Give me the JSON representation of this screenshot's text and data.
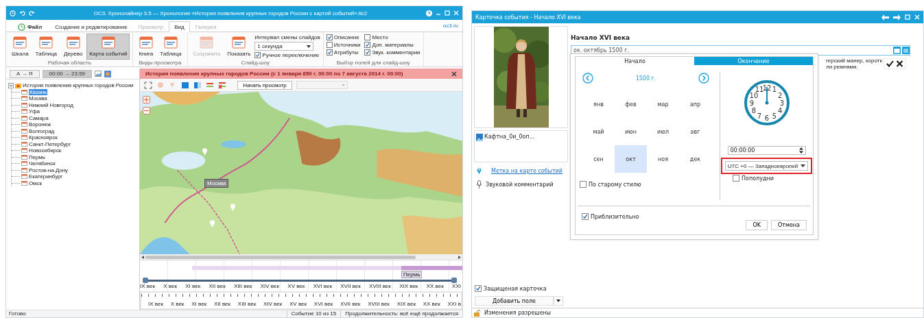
{
  "left_window": {
    "title": "ОС3. Хронолайнер 3.5 — Хронология «История появления крупных городов России с картой событий».tlc2",
    "ribbon_tabs": [
      {
        "label": "Файл",
        "kind": "file",
        "selected": false,
        "disabled": false
      },
      {
        "label": "Создание и редактирование",
        "kind": "tab",
        "selected": false,
        "disabled": false
      },
      {
        "label": "Просмотр",
        "kind": "tab",
        "selected": false,
        "disabled": true
      },
      {
        "label": "Вид",
        "kind": "tab",
        "selected": true,
        "disabled": false
      },
      {
        "label": "Галерея",
        "kind": "tab",
        "selected": false,
        "disabled": true
      }
    ],
    "site_link": "oc3.ru",
    "ribbon_groups": [
      {
        "title": "Рабочая область",
        "items": [
          {
            "kind": "button",
            "label": "Шкала",
            "selected": false,
            "disabled": false
          },
          {
            "kind": "button",
            "label": "Таблица",
            "selected": false,
            "disabled": false
          },
          {
            "kind": "button",
            "label": "Дерево",
            "selected": false,
            "disabled": false
          },
          {
            "kind": "button",
            "label": "Карта событий",
            "selected": true,
            "disabled": false
          }
        ]
      },
      {
        "title": "Виды просмотра",
        "items": [
          {
            "kind": "button",
            "label": "Книга",
            "selected": false,
            "disabled": false
          },
          {
            "kind": "button",
            "label": "Таблица",
            "selected": false,
            "disabled": false
          }
        ]
      },
      {
        "title": "Слайд-шоу",
        "items": [
          {
            "kind": "button",
            "label": "Сохранить",
            "selected": false,
            "disabled": true
          },
          {
            "kind": "button",
            "label": "Показать",
            "selected": false,
            "disabled": false
          },
          {
            "kind": "label",
            "label": "Интервал смены слайдов"
          },
          {
            "kind": "dropdown",
            "value": "1 секунда"
          },
          {
            "kind": "checkbox",
            "label": "Ручное переключение",
            "checked": true
          }
        ]
      },
      {
        "title": "Выбор полей для слайд-шоу",
        "items": [
          {
            "kind": "checkbox",
            "label": "Описание",
            "checked": true
          },
          {
            "kind": "checkbox",
            "label": "Место",
            "checked": false
          },
          {
            "kind": "checkbox",
            "label": "Источники",
            "checked": false
          },
          {
            "kind": "checkbox",
            "label": "Доп. материалы",
            "checked": true
          },
          {
            "kind": "checkbox",
            "label": "Атрибуты",
            "checked": true
          },
          {
            "kind": "checkbox",
            "label": "Звук. комментарии",
            "checked": true
          }
        ]
      }
    ],
    "sort_button": "А → Я",
    "time_button": "00:00 → 23:59",
    "banner": "История появления крупных городов России (с 1 января 850 г. 00:00 по 7 августа 2014 г. 00:00)",
    "tree": {
      "label": "История появления крупных городов России",
      "expanded": true,
      "children": [
        {
          "label": "Казань",
          "selected": true
        },
        {
          "label": "Москва",
          "selected": false
        },
        {
          "label": "Нижний Новгород",
          "selected": false
        },
        {
          "label": "Уфа",
          "selected": false
        },
        {
          "label": "Самара",
          "selected": false
        },
        {
          "label": "Воронеж",
          "selected": false
        },
        {
          "label": "Волгоград",
          "selected": false
        },
        {
          "label": "Красноярск",
          "selected": false
        },
        {
          "label": "Санкт-Петербург",
          "selected": false
        },
        {
          "label": "Новосибирск",
          "selected": false
        },
        {
          "label": "Пермь",
          "selected": false
        },
        {
          "label": "Челябинск",
          "selected": false
        },
        {
          "label": "Ростов-на-Дону",
          "selected": false
        },
        {
          "label": "Екатеринбург",
          "selected": false
        },
        {
          "label": "Омск",
          "selected": false
        }
      ]
    },
    "start_button": "Начать просмотр",
    "map_label": "Москва",
    "timeline_label": "Пермь",
    "timeline_centuries": [
      "IX век",
      "X век",
      "XI век",
      "XII век",
      "XIII век",
      "XIV век",
      "XV век",
      "XVI век",
      "XVII век",
      "XVIII век",
      "XIX век",
      "XX век",
      "XXI"
    ],
    "ruler_centuries": [
      "IX век",
      "X век",
      "XI век",
      "XII век",
      "XIII век",
      "XIV век",
      "XV век",
      "XVI век",
      "XVII век",
      "XVIII век",
      "XIX век",
      "XX век",
      "XXI в"
    ],
    "status": "Готово",
    "event_counter": "Событие 10 из 15",
    "duration": "Продолжительность: всё ещё продолжается"
  },
  "right_window": {
    "title": "Карточка события - Начало XVI века",
    "image_caption": "Кафтна_0и_0оп...",
    "map_link": "Метка на карте событий",
    "audio_label": "Звуковой комментарий",
    "heading": "Начало XVI века",
    "date_value": "ок. октябрь 1500 г.",
    "description_lines": [
      "герский манер, коротк",
      "ли ремнями."
    ],
    "popup": {
      "tabs": [
        {
          "label": "Начало",
          "selected": true
        },
        {
          "label": "Окончание",
          "selected": false
        }
      ],
      "year": "1500 г.",
      "months": [
        {
          "label": "янв",
          "selected": false
        },
        {
          "label": "фев",
          "selected": false
        },
        {
          "label": "мар",
          "selected": false
        },
        {
          "label": "апр",
          "selected": false
        },
        {
          "label": "май",
          "selected": false
        },
        {
          "label": "июн",
          "selected": false
        },
        {
          "label": "июл",
          "selected": false
        },
        {
          "label": "авг",
          "selected": false
        },
        {
          "label": "сен",
          "selected": false
        },
        {
          "label": "окт",
          "selected": true
        },
        {
          "label": "ноя",
          "selected": false
        },
        {
          "label": "дек",
          "selected": false
        }
      ],
      "old_style": {
        "label": "По старому стилю",
        "checked": false
      },
      "clock_numerals": [
        "11",
        "12",
        "1",
        "10",
        "2",
        "9",
        "3",
        "8",
        "4",
        "7",
        "6",
        "5"
      ],
      "time": "00:00:00",
      "timezone": "UTC +0 — Западноевропей",
      "pm": {
        "label": "Пополудни",
        "checked": false
      },
      "approximate": {
        "label": "Приблизительно",
        "checked": true
      },
      "buttons": [
        "OK",
        "Отмена"
      ]
    },
    "protected": {
      "label": "Защищеная карточка",
      "checked": true
    },
    "add_field_button": "Добавить поле",
    "status": "Изменения разрешены"
  }
}
